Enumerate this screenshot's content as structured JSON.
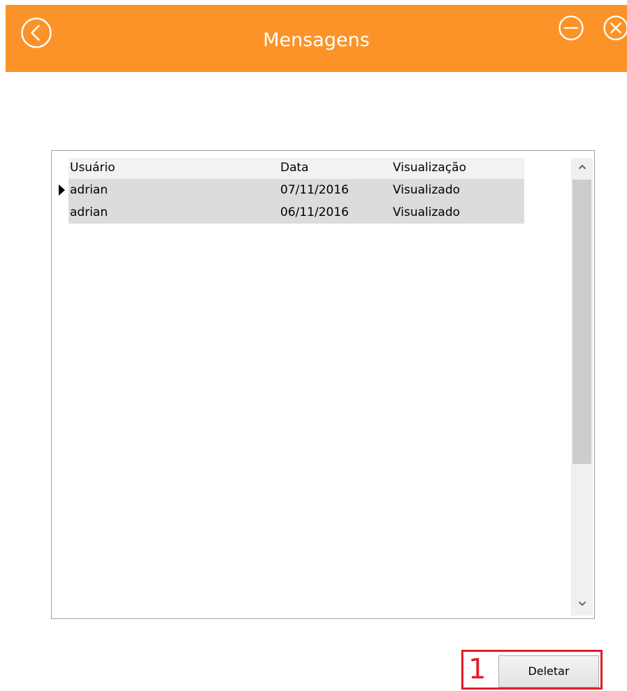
{
  "window": {
    "title": "Mensagens",
    "accent_color": "#fb9328",
    "back_icon": "chevron-left-circle",
    "minimize_icon": "minus-circle",
    "close_icon": "x-circle"
  },
  "grid": {
    "columns": [
      "Usuário",
      "Data",
      "Visualização"
    ],
    "rows": [
      {
        "usuario": "adrian",
        "data": "07/11/2016",
        "visualizacao": "Visualizado",
        "current": true
      },
      {
        "usuario": "adrian",
        "data": "06/11/2016",
        "visualizacao": "Visualizado",
        "current": false
      }
    ],
    "row_background": "#dcdcdc"
  },
  "actions": {
    "delete_label": "Deletar",
    "annotation_number": "1",
    "annotation_color": "#e31d2b"
  }
}
